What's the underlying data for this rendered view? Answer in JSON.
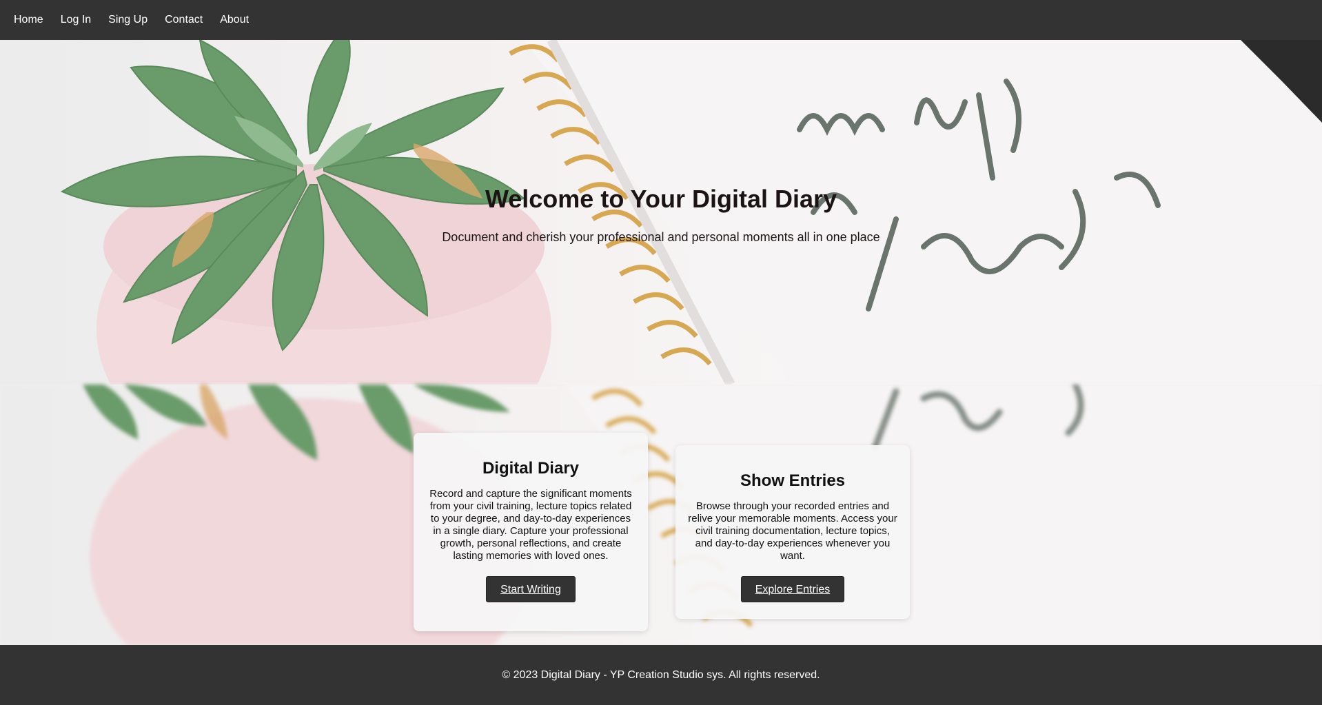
{
  "nav": {
    "items": [
      {
        "label": "Home"
      },
      {
        "label": "Log In"
      },
      {
        "label": "Sing Up"
      },
      {
        "label": "Contact"
      },
      {
        "label": "About"
      }
    ]
  },
  "hero": {
    "title": "Welcome to Your Digital Diary",
    "subtitle": "Document and cherish your professional and personal moments all in one place"
  },
  "cards": [
    {
      "title": "Digital Diary",
      "text": "Record and capture the significant moments from your civil training, lecture topics related to your degree, and day-to-day experiences in a single diary. Capture your professional growth, personal reflections, and create lasting memories with loved ones.",
      "button": "Start Writing"
    },
    {
      "title": "Show Entries",
      "text": "Browse through your recorded entries and relive your memorable moments. Access your civil training documentation, lecture topics, and day-to-day experiences whenever you want.",
      "button": "Explore Entries"
    }
  ],
  "footer": {
    "text": "© 2023 Digital Diary - YP Creation Studio sys. All rights reserved."
  },
  "colors": {
    "nav_bg": "#333333",
    "footer_bg": "#333333",
    "button_bg": "#333333",
    "plant": "#6a9b6a",
    "pot": "#f1d9dc",
    "spiral": "#d9a23a"
  }
}
